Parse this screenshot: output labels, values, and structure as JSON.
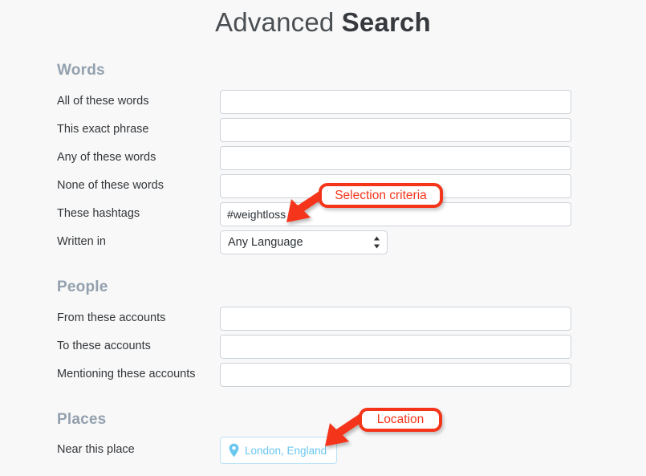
{
  "page": {
    "title_light": "Advanced",
    "title_bold": "Search",
    "background_color": "#f8f8f8",
    "heading_color": "#93a0ae",
    "annotation_color": "#f4351a",
    "chip_accent_color": "#69c7ef"
  },
  "sections": [
    {
      "id": "words",
      "heading": "Words",
      "rows": [
        {
          "label": "All of these words",
          "type": "text",
          "value": "",
          "placeholder": ""
        },
        {
          "label": "This exact phrase",
          "type": "text",
          "value": "",
          "placeholder": ""
        },
        {
          "label": "Any of these words",
          "type": "text",
          "value": "",
          "placeholder": ""
        },
        {
          "label": "None of these words",
          "type": "text",
          "value": "",
          "placeholder": ""
        },
        {
          "label": "These hashtags",
          "type": "text",
          "value": "#weightloss",
          "placeholder": ""
        },
        {
          "label": "Written in",
          "type": "select",
          "value": "Any Language",
          "options": [
            "Any Language"
          ]
        }
      ]
    },
    {
      "id": "people",
      "heading": "People",
      "rows": [
        {
          "label": "From these accounts",
          "type": "text",
          "value": "",
          "placeholder": ""
        },
        {
          "label": "To these accounts",
          "type": "text",
          "value": "",
          "placeholder": ""
        },
        {
          "label": "Mentioning these accounts",
          "type": "text",
          "value": "",
          "placeholder": ""
        }
      ]
    },
    {
      "id": "places",
      "heading": "Places",
      "rows": [
        {
          "label": "Near this place",
          "type": "chip",
          "value": "London, England",
          "icon": "map-pin-icon"
        }
      ]
    }
  ],
  "annotations": [
    {
      "id": "selection-criteria",
      "label": "Selection criteria"
    },
    {
      "id": "location",
      "label": "Location"
    }
  ]
}
